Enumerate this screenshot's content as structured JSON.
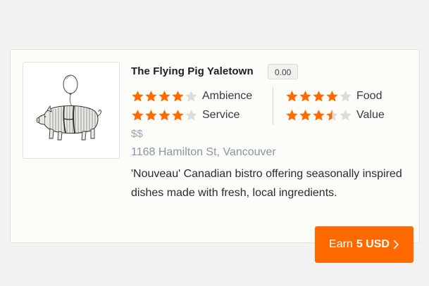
{
  "restaurant": {
    "name": "The Flying Pig Yaletown",
    "score": "0.00",
    "price": "$$",
    "address": "1168 Hamilton St, Vancouver",
    "description": "'Nouveau' Canadian bistro offering seasonally inspired dishes made with fresh, local ingredients.",
    "logo_icon": "flying-pig-balloon-icon"
  },
  "ratings": [
    {
      "label": "Ambience",
      "stars": 4,
      "max": 5
    },
    {
      "label": "Service",
      "stars": 4,
      "max": 5
    },
    {
      "label": "Food",
      "stars": 4,
      "max": 5
    },
    {
      "label": "Value",
      "stars": 3.5,
      "max": 5
    }
  ],
  "earn_button": {
    "prefix": "Earn",
    "amount": "5 USD",
    "icon": "chevron-right-icon"
  },
  "colors": {
    "star_filled": "#ff6a00",
    "star_empty": "#dcdcdc",
    "accent": "#ff6a00"
  }
}
